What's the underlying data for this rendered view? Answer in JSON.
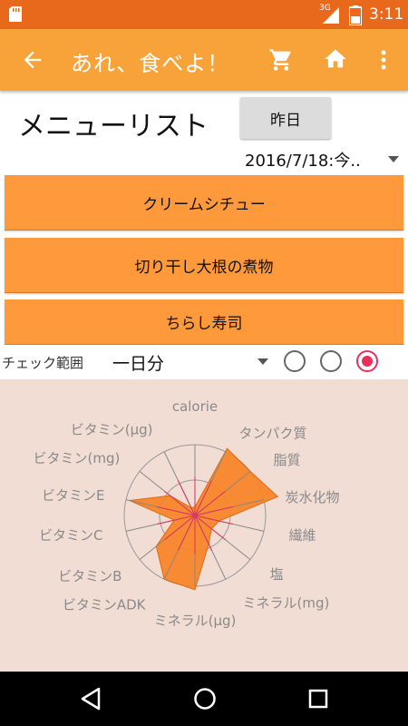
{
  "status_bar": {
    "network": "3G",
    "time": "3:11"
  },
  "app_bar": {
    "title": "あれ、食べよ！",
    "icons": [
      "back-arrow-icon",
      "cart-icon",
      "home-icon",
      "more-vert-icon"
    ]
  },
  "menu": {
    "title": "メニューリスト",
    "yesterday_label": "昨日",
    "date_selected": "2016/7/18:今..",
    "items": [
      {
        "label": "クリームシチュー"
      },
      {
        "label": "切り干し大根の煮物"
      },
      {
        "label": "ちらし寿司"
      }
    ]
  },
  "check": {
    "label": "チェック範囲",
    "range_selected": "一日分",
    "radios": [
      false,
      false,
      true
    ]
  },
  "colors": {
    "status_bar": "#e8691b",
    "app_bar": "#f7a33a",
    "menu_item": "#ff9a3c",
    "chart_bg": "#f1ddd4",
    "radar_fill": "#f7852a",
    "accent": "#e8305c"
  },
  "chart_data": {
    "type": "radar",
    "axes": [
      "calorie",
      "タンパク質",
      "脂質",
      "炭水化物",
      "繊維",
      "塩",
      "ミネラル(mg)",
      "ミネラル(μg)",
      "ビタミンADK",
      "ビタミンB",
      "ビタミンC",
      "ビタミンE",
      "ビタミン(mg)",
      "ビタミン(μg)"
    ],
    "values": [
      0.12,
      1.05,
      1.0,
      1.2,
      0.35,
      0.3,
      0.45,
      1.05,
      1.0,
      0.7,
      0.3,
      0.95,
      0.45,
      0.12
    ],
    "rings": 2
  }
}
